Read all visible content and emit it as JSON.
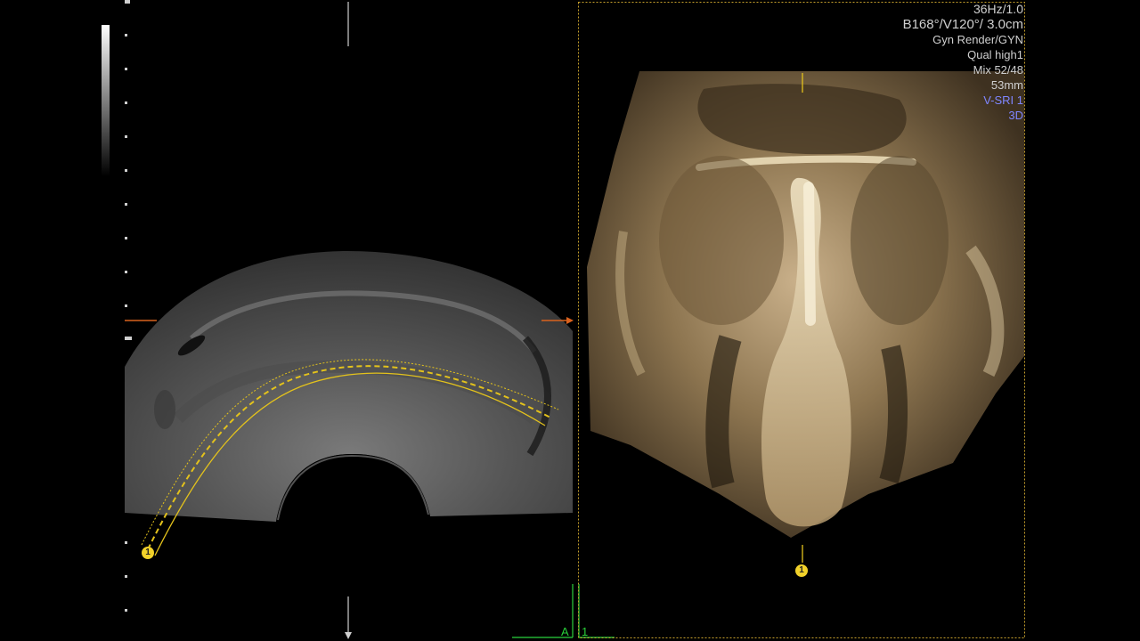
{
  "overlay": {
    "lines": [
      "36Hz/1.0",
      "B168°/V120°/ 3.0cm",
      "Gyn Render/GYN",
      "Qual high1",
      "Mix 52/48",
      "53mm",
      "V-SRI 1",
      "3D"
    ],
    "accent_blue": "#7f86ff"
  },
  "markers": {
    "pin_left": "1",
    "pin_right": "1",
    "axis_a": "A",
    "axis_1": "1"
  },
  "colors": {
    "curve_yellow": "#e3c21c",
    "reference_orange": "#d9621e",
    "axis_green": "#2bd23d",
    "frame_yellow": "#c6a02c"
  },
  "grayscale_bar": {
    "icon": "grayscale-bar-icon"
  }
}
